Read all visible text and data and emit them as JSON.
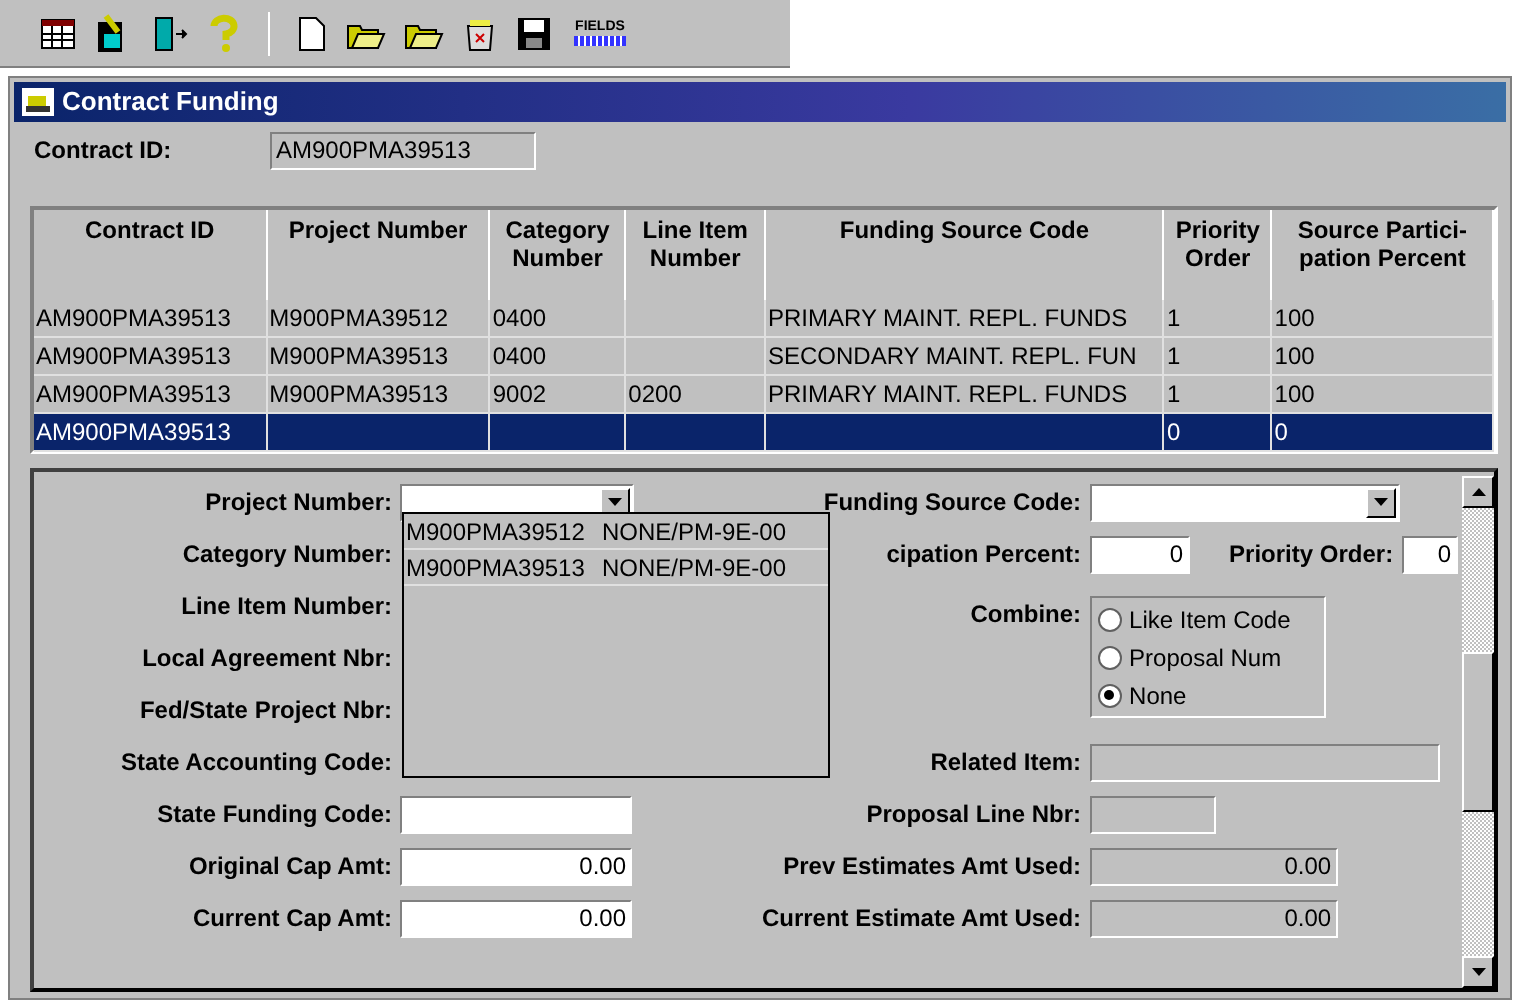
{
  "toolbar": [
    {
      "kind": "grid"
    },
    {
      "kind": "pen"
    },
    {
      "kind": "door"
    },
    {
      "kind": "help"
    },
    {
      "kind": "sep"
    },
    {
      "kind": "new"
    },
    {
      "kind": "open"
    },
    {
      "kind": "open"
    },
    {
      "kind": "trash"
    },
    {
      "kind": "save"
    },
    {
      "kind": "fields",
      "label": "FIELDS"
    }
  ],
  "window": {
    "title": "Contract Funding"
  },
  "contract_id": {
    "label": "Contract ID:",
    "value": "AM900PMA39513"
  },
  "table": {
    "columns": [
      "Contract ID",
      "Project Number",
      "Category Number",
      "Line Item Number",
      "Funding Source Code",
      "Priority Order",
      "Source Partici- pation Percent"
    ],
    "rows": [
      {
        "selected": false,
        "cells": [
          "AM900PMA39513",
          "M900PMA39512",
          "0400",
          "",
          "PRIMARY MAINT. REPL. FUNDS",
          "1",
          "100"
        ]
      },
      {
        "selected": false,
        "cells": [
          "AM900PMA39513",
          "M900PMA39513",
          "0400",
          "",
          "SECONDARY MAINT. REPL. FUN",
          "1",
          "100"
        ]
      },
      {
        "selected": false,
        "cells": [
          "AM900PMA39513",
          "M900PMA39513",
          "9002",
          "0200",
          "PRIMARY MAINT. REPL. FUNDS",
          "1",
          "100"
        ]
      },
      {
        "selected": true,
        "cells": [
          "AM900PMA39513",
          "",
          "",
          "",
          "",
          "0",
          "0"
        ]
      }
    ]
  },
  "form_left": [
    {
      "label": "Project Number:",
      "kind": "combo"
    },
    {
      "label": "Category Number:",
      "kind": "hidden"
    },
    {
      "label": "Line Item Number:",
      "kind": "hidden"
    },
    {
      "label": "Local Agreement Nbr:",
      "kind": "hidden"
    },
    {
      "label": "Fed/State Project Nbr:",
      "kind": "hidden"
    },
    {
      "label": "State Accounting Code:",
      "kind": "hidden"
    },
    {
      "label": "State Funding Code:",
      "kind": "text"
    },
    {
      "label": "Original Cap Amt:",
      "kind": "amount",
      "value": "0.00"
    },
    {
      "label": "Current Cap Amt:",
      "kind": "amount",
      "value": "0.00"
    }
  ],
  "dropdown": {
    "items": [
      {
        "selected": false,
        "columns": [
          "M900PMA39512",
          "NONE/PM-9E-00"
        ]
      },
      {
        "selected": false,
        "columns": [
          "M900PMA39513",
          "NONE/PM-9E-00"
        ]
      }
    ]
  },
  "form_right": [
    {
      "label": "Funding Source Code:",
      "kind": "combo"
    },
    {
      "label": "cipation Percent:",
      "kind": "pair",
      "value": "0",
      "label2": "Priority Order:",
      "value2": "0"
    },
    {
      "label": "Combine:",
      "kind": "radio",
      "options": [
        {
          "label": "Like Item Code",
          "selected": false
        },
        {
          "label": "Proposal Num",
          "selected": false
        },
        {
          "label": "None",
          "selected": true
        }
      ]
    },
    {
      "label": "Related Item:",
      "kind": "readonly"
    },
    {
      "label": "Proposal Line Nbr:",
      "kind": "readonly"
    },
    {
      "label": "Prev Estimates Amt Used:",
      "kind": "readonly",
      "value": "0.00"
    },
    {
      "label": "Current Estimate Amt Used:",
      "kind": "readonly",
      "value": "0.00"
    }
  ]
}
